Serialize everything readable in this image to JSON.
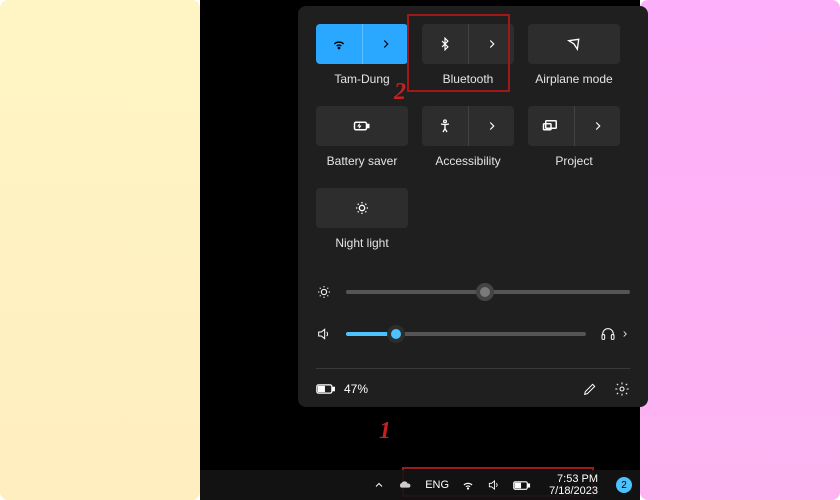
{
  "tiles": {
    "row1": [
      {
        "label": "Tam-Dung",
        "icon": "wifi-icon",
        "active": true,
        "hasChevron": true
      },
      {
        "label": "Bluetooth",
        "icon": "bluetooth-icon",
        "active": false,
        "hasChevron": true
      },
      {
        "label": "Airplane mode",
        "icon": "airplane-icon",
        "active": false,
        "hasChevron": false
      }
    ],
    "row2": [
      {
        "label": "Battery saver",
        "icon": "battery-saver-icon",
        "active": false,
        "hasChevron": false
      },
      {
        "label": "Accessibility",
        "icon": "accessibility-icon",
        "active": false,
        "hasChevron": true
      },
      {
        "label": "Project",
        "icon": "project-icon",
        "active": false,
        "hasChevron": true
      }
    ],
    "row3": [
      {
        "label": "Night light",
        "icon": "night-light-icon",
        "active": false,
        "hasChevron": false
      }
    ]
  },
  "sliders": {
    "brightness": 49,
    "volume": 21
  },
  "footer": {
    "battery_text": "47%"
  },
  "annotations": {
    "mark1": "1",
    "mark2": "2"
  },
  "taskbar": {
    "lang": "ENG",
    "time": "7:53 PM",
    "date": "7/18/2023",
    "notif_count": "2"
  }
}
